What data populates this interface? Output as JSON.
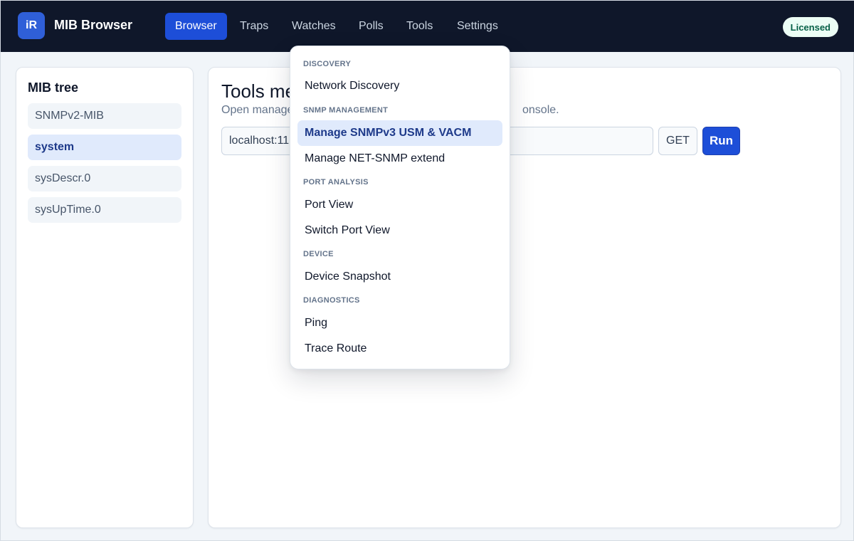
{
  "app": {
    "logo_text": "iR",
    "title": "MIB Browser"
  },
  "nav": {
    "items": [
      {
        "label": "Browser",
        "active": true
      },
      {
        "label": "Traps"
      },
      {
        "label": "Watches"
      },
      {
        "label": "Polls"
      },
      {
        "label": "Tools"
      },
      {
        "label": "Settings"
      }
    ],
    "license_badge": "Licensed"
  },
  "sidebar": {
    "title": "MIB tree",
    "items": [
      {
        "label": "SNMPv2-MIB"
      },
      {
        "label": "system",
        "selected": true
      },
      {
        "label": "sysDescr.0"
      },
      {
        "label": "sysUpTime.0"
      }
    ]
  },
  "main": {
    "title": "Tools me",
    "subtitle_left": "Open manage",
    "subtitle_right": "onsole.",
    "target_value": "localhost:11",
    "operation": "GET",
    "run_label": "Run"
  },
  "tools_menu": {
    "groups": [
      {
        "label": "DISCOVERY",
        "items": [
          "Network Discovery"
        ]
      },
      {
        "label": "SNMP MANAGEMENT",
        "items": [
          "Manage SNMPv3 USM & VACM",
          "Manage NET-SNMP extend"
        ]
      },
      {
        "label": "PORT ANALYSIS",
        "items": [
          "Port View",
          "Switch Port View"
        ]
      },
      {
        "label": "DEVICE",
        "items": [
          "Device Snapshot"
        ]
      },
      {
        "label": "DIAGNOSTICS",
        "items": [
          "Ping",
          "Trace Route"
        ]
      }
    ],
    "highlighted_item": "Manage SNMPv3 USM & VACM"
  },
  "colors": {
    "topbar": "#0f172a",
    "accent": "#1d4ed8",
    "selected_bg": "#e0eafc",
    "selected_text": "#1e3a8a",
    "license_bg": "#ecfdf5",
    "license_text": "#065f46"
  }
}
